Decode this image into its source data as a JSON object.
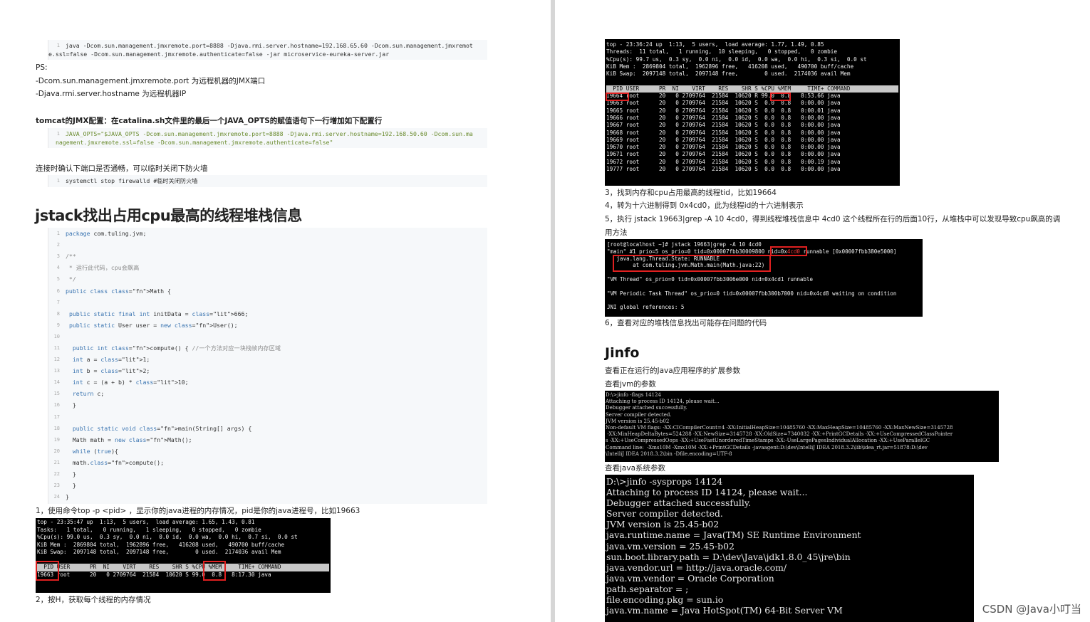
{
  "left": {
    "cmd1": {
      "line_no": "1",
      "text1": "java -Dcom.sun.management.jmxremote.port=8888 -Djava.rmi.server.hostname=192.168.65.60 -Dcom.sun.management.jmxremot",
      "text2": "e.ssl=false -Dcom.sun.management.jmxremote.authenticate=false -jar microservice-eureka-server.jar"
    },
    "ps": "PS:",
    "ps_line1": "-Dcom.sun.management.jmxremote.port 为远程机器的JMX端口",
    "ps_line2": "-Djava.rmi.server.hostname 为远程机器IP",
    "tomcat_heading": "tomcat的JMX配置：在catalina.sh文件里的最后一个JAVA_OPTS的赋值语句下一行增加如下配置行",
    "cmd2": {
      "line_no": "1",
      "text1": "JAVA_OPTS=\"$JAVA_OPTS -Dcom.sun.management.jmxremote.port=8888 -Djava.rmi.server.hostname=192.168.50.60 -Dcom.sun.ma",
      "text2": "nagement.jmxremote.ssl=false -Dcom.sun.management.jmxremote.authenticate=false\""
    },
    "firewall_text": "连接时确认下端口是否通畅，可以临时关闭下防火墙",
    "cmd3": {
      "line_no": "1",
      "text": "systemctl stop firewalld #临时关闭防火墙"
    },
    "section_title": "jstack找出占用cpu最高的线程堆栈信息",
    "code_lines": [
      {
        "n": "1",
        "t": "package com.tuling.jvm;"
      },
      {
        "n": "2",
        "t": ""
      },
      {
        "n": "3",
        "t": "/**"
      },
      {
        "n": "4",
        "t": " * 运行此代码，cpu会飙高"
      },
      {
        "n": "5",
        "t": " */"
      },
      {
        "n": "6",
        "t": "public class Math {"
      },
      {
        "n": "7",
        "t": ""
      },
      {
        "n": "8",
        "t": " public static final int initData = 666;"
      },
      {
        "n": "9",
        "t": " public static User user = new User();"
      },
      {
        "n": "10",
        "t": ""
      },
      {
        "n": "11",
        "t": "  public int compute() { //一个方法对应一块栈帧内存区域"
      },
      {
        "n": "12",
        "t": "  int a = 1;"
      },
      {
        "n": "13",
        "t": "  int b = 2;"
      },
      {
        "n": "14",
        "t": "  int c = (a + b) * 10;"
      },
      {
        "n": "15",
        "t": "  return c;"
      },
      {
        "n": "16",
        "t": "  }"
      },
      {
        "n": "17",
        "t": ""
      },
      {
        "n": "18",
        "t": "  public static void main(String[] args) {"
      },
      {
        "n": "19",
        "t": "  Math math = new Math();"
      },
      {
        "n": "20",
        "t": "  while (true){"
      },
      {
        "n": "21",
        "t": "  math.compute();"
      },
      {
        "n": "22",
        "t": "  }"
      },
      {
        "n": "23",
        "t": "  }"
      },
      {
        "n": "24",
        "t": "}"
      }
    ],
    "step1": "1，使用命令top -p <pid> ，显示你的java进程的内存情况，pid是你的java进程号，比如19663",
    "top1": {
      "lines": [
        "top - 23:35:47 up  1:13,  5 users,  load average: 1.65, 1.43, 0.81",
        "Tasks:   1 total,   0 running,   1 sleeping,   0 stopped,   0 zombie",
        "%Cpu(s): 99.0 us,  0.3 sy,  0.0 ni,  0.0 id,  0.0 wa,  0.0 hi,  0.7 si,  0.0 st",
        "KiB Mem :  2869804 total,  1962896 free,   416208 used,   490700 buff/cache",
        "KiB Swap:  2097148 total,  2097148 free,        0 used.  2174036 avail Mem"
      ],
      "header": "  PID USER      PR  NI    VIRT    RES    SHR S %CPU %MEM     TIME+ COMMAND",
      "row": "19663 root      20   0 2709764  21584  10620 S 99.0  0.8   8:17.30 java"
    },
    "step2": "2，按H，获取每个线程的内存情况"
  },
  "right": {
    "top2": {
      "lines": [
        "top - 23:36:24 up  1:13,  5 users,  load average: 1.77, 1.49, 0.85",
        "Threads:  11 total,   1 running,  10 sleeping,   0 stopped,   0 zombie",
        "%Cpu(s): 99.7 us,  0.3 sy,  0.0 ni,  0.0 id,  0.0 wa,  0.0 hi,  0.3 si,  0.0 st",
        "KiB Mem :  2869804 total,  1962896 free,   416208 used,   490700 buff/cache",
        "KiB Swap:  2097148 total,  2097148 free,        0 used.  2174036 avail Mem"
      ],
      "header": "  PID USER      PR  NI    VIRT    RES    SHR S %CPU %MEM     TIME+ COMMAND",
      "rows": [
        "19664 root      20   0 2709764  21584  10620 R 99.0  0.8   8:53.66 java",
        "19663 root      20   0 2709764  21584  10620 S  0.0  0.8   0:00.00 java",
        "19665 root      20   0 2709764  21584  10620 S  0.0  0.8   0:00.01 java",
        "19666 root      20   0 2709764  21584  10620 S  0.0  0.8   0:00.00 java",
        "19667 root      20   0 2709764  21584  10620 S  0.0  0.8   0:00.00 java",
        "19668 root      20   0 2709764  21584  10620 S  0.0  0.8   0:00.00 java",
        "19669 root      20   0 2709764  21584  10620 S  0.0  0.8   0:00.00 java",
        "19670 root      20   0 2709764  21584  10620 S  0.0  0.8   0:00.00 java",
        "19671 root      20   0 2709764  21584  10620 S  0.0  0.8   0:00.00 java",
        "19672 root      20   0 2709764  21584  10620 S  0.0  0.8   0:00.19 java",
        "19777 root      20   0 2709764  21584  10620 S  0.0  0.8   0:00.00 java"
      ]
    },
    "step3": "3，找到内存和cpu占用最高的线程tid，比如19664",
    "step4": "4，转为十六进制得到 0x4cd0，此为线程id的十六进制表示",
    "step5a": "5，执行 jstack 19663|grep -A 10 4cd0，得到线程堆栈信息中 4cd0 这个线程所在行的后面10行，从堆栈中可以发现导致cpu飙高的调",
    "step5b": "用方法",
    "jstack": {
      "prompt": "[root@localhost ~]# jstack 19663|grep -A 10 4cd0",
      "main_pre": "\"main\" #1 prio=5 os_prio=0 tid=0x00007fbb30009800 ",
      "main_nid_pre": "nid=0x",
      "main_nid_hex": "4cd0",
      "main_post": " runnable [0x00007fbb380e5000]",
      "state": "   java.lang.Thread.State: RUNNABLE",
      "at": "        at com.tuling.jvm.Math.main(Math.java:22)",
      "vm_thread": "\"VM Thread\" os_prio=0 tid=0x00007fbb3006e000 nid=0x4cd1 runnable",
      "vm_periodic": "\"VM Periodic Task Thread\" os_prio=0 tid=0x00007fbb300b7000 nid=0x4cd8 waiting on condition",
      "jni": "JNI global references: 5"
    },
    "step6": "6，查看对应的堆栈信息找出可能存在问题的代码",
    "jinfo_title": "Jinfo",
    "jinfo_desc": "查看正在运行的Java应用程序的扩展参数",
    "jvm_params_label": "查看jvm的参数",
    "flags_lines": [
      "D:\\>jinfo -flags 14124",
      "Attaching to process ID 14124, please wait...",
      "Debugger attached successfully.",
      "Server compiler detected.",
      "JVM version is 25.45-b02",
      "Non-default VM flags: -XX:CICompilerCount=4 -XX:InitialHeapSize=10485760 -XX:MaxHeapSize=10485760 -XX:MaxNewSize=3145728",
      " -XX:MinHeapDeltaBytes=524288 -XX:NewSize=3145728 -XX:OldSize=7340032 -XX:+PrintGCDetails -XX:+UseCompressedClassPointer",
      "s -XX:+UseCompressedOops -XX:+UseFastUnorderedTimeStamps -XX:-UseLargePagesIndividualAllocation -XX:+UseParallelGC",
      "Command line:  -Xms10M -Xmx10M -XX:+PrintGCDetails -javaagent:D:\\dev\\IntelliJ IDEA 2018.3.2\\lib\\idea_rt.jar=51878:D:\\dev",
      "\\IntelliJ IDEA 2018.3.2\\bin -Dfile.encoding=UTF-8"
    ],
    "sys_params_label": "查看java系统参数",
    "sysprops_lines": [
      "D:\\>jinfo -sysprops 14124",
      "Attaching to process ID 14124, please wait...",
      "Debugger attached successfully.",
      "Server compiler detected.",
      "JVM version is 25.45-b02",
      "java.runtime.name = Java(TM) SE Runtime Environment",
      "java.vm.version = 25.45-b02",
      "sun.boot.library.path = D:\\dev\\Java\\jdk1.8.0_45\\jre\\bin",
      "java.vendor.url = http://java.oracle.com/",
      "java.vm.vendor = Oracle Corporation",
      "path.separator = ;",
      "file.encoding.pkg = sun.io",
      "java.vm.name = Java HotSpot(TM) 64-Bit Server VM"
    ]
  },
  "watermark": "CSDN @Java小叮当",
  "colors": {
    "keyword": "#3873b0",
    "string": "#6a8b2e",
    "highlight_box": "#e02020",
    "terminal_bg": "#000000"
  }
}
